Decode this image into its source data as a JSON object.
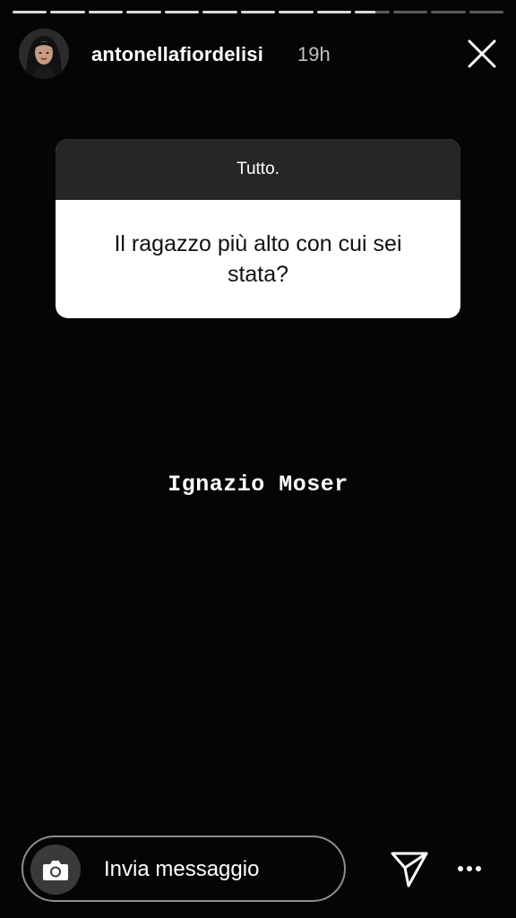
{
  "story": {
    "progress": [
      1,
      1,
      1,
      1,
      1,
      1,
      1,
      1,
      1,
      0.6,
      0,
      0,
      0
    ]
  },
  "header": {
    "username": "antonellafiordelisi",
    "time": "19h",
    "avatar_icon": "profile-avatar",
    "close_icon": "close-icon"
  },
  "question_sticker": {
    "header": "Tutto.",
    "question": "Il ragazzo più alto con cui sei stata?"
  },
  "answer": {
    "text": "Ignazio Moser"
  },
  "footer": {
    "reply_placeholder": "Invia messaggio",
    "camera_icon": "camera-icon",
    "send_icon": "send-icon",
    "more_icon": "more-icon"
  },
  "colors": {
    "background": "#050505",
    "card_header": "#262626",
    "card_body": "#ffffff"
  }
}
